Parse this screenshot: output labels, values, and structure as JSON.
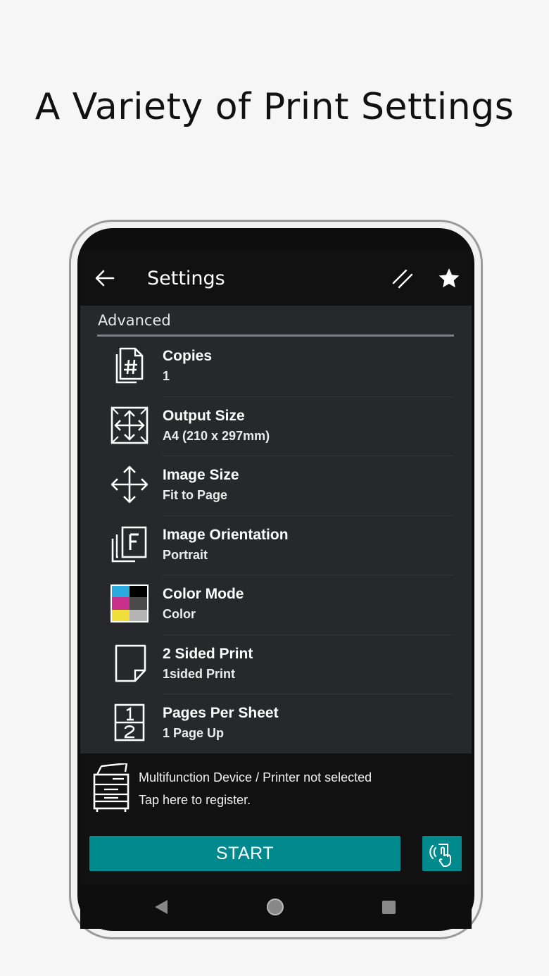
{
  "headline": "A Variety of Print Settings",
  "appbar": {
    "title": "Settings",
    "icons": [
      "back-arrow-icon",
      "pen-icon",
      "star-icon"
    ]
  },
  "section": "Advanced",
  "settings": [
    {
      "label": "Copies",
      "value": "1",
      "icon": "copies-icon"
    },
    {
      "label": "Output Size",
      "value": "A4 (210 x 297mm)",
      "icon": "output-size-icon"
    },
    {
      "label": "Image Size",
      "value": "Fit to Page",
      "icon": "move-arrows-icon"
    },
    {
      "label": "Image Orientation",
      "value": "Portrait",
      "icon": "orientation-icon"
    },
    {
      "label": "Color Mode",
      "value": "Color",
      "icon": "color-mode-icon"
    },
    {
      "label": "2 Sided Print",
      "value": "1sided Print",
      "icon": "page-icon"
    },
    {
      "label": "Pages Per Sheet",
      "value": "1 Page Up",
      "icon": "pages-per-sheet-icon"
    }
  ],
  "device": {
    "line1": "Multifunction Device / Printer not selected",
    "line2": "Tap here to register.",
    "icon": "printer-icon"
  },
  "start_label": "START",
  "colors": {
    "accent": "#008a8d",
    "bar": "#111111",
    "list_bg": "#27282c",
    "page_bg": "#f6f6f6"
  }
}
